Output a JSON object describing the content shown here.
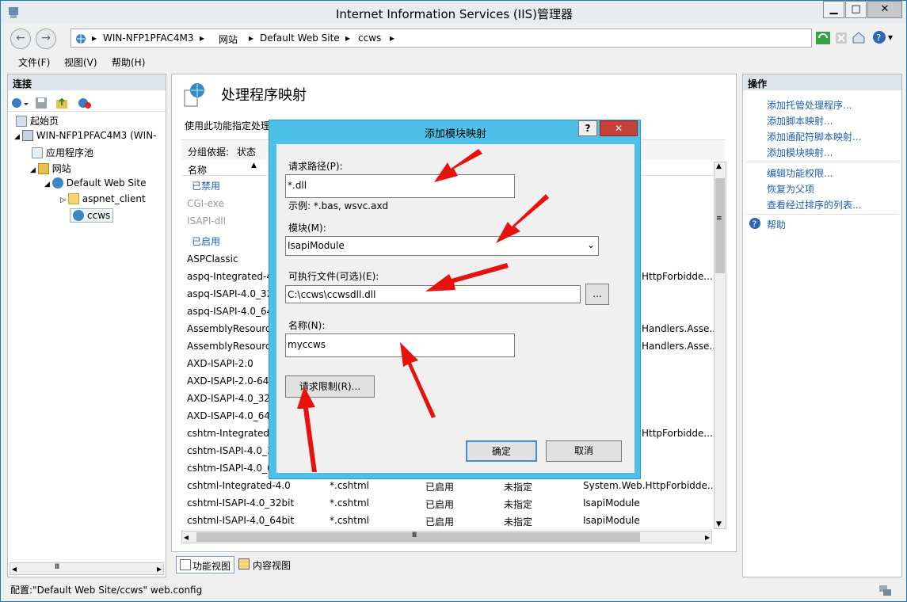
{
  "window": {
    "title": "Internet Information Services (IIS)管理器"
  },
  "address": {
    "segments": [
      "WIN-NFP1PFAC4M3",
      "网站",
      "Default Web Site",
      "ccws"
    ]
  },
  "menu": {
    "file": "文件(F)",
    "view": "视图(V)",
    "help": "帮助(H)"
  },
  "left": {
    "title": "连接",
    "tree": {
      "start": "起始页",
      "server": "WIN-NFP1PFAC4M3 (WIN-",
      "apppools": "应用程序池",
      "sites": "网站",
      "dws": "Default Web Site",
      "aspnet": "aspnet_client",
      "ccws": "ccws"
    }
  },
  "center": {
    "title": "处理程序映射",
    "desc": "使用此功能指定处理",
    "groupby_label": "分组依据:",
    "groupby_value": "状态",
    "col_name": "名称",
    "group_disabled": "已禁用",
    "group_enabled": "已启用",
    "disabled_rows": [
      "CGI-exe",
      "ISAPI-dll"
    ],
    "rows": [
      {
        "name": "ASPClassic",
        "tail": ""
      },
      {
        "name": "aspq-Integrated-4",
        "tail": "HttpForbidde..."
      },
      {
        "name": "aspq-ISAPI-4.0_32",
        "tail": ""
      },
      {
        "name": "aspq-ISAPI-4.0_64",
        "tail": ""
      },
      {
        "name": "AssemblyResourc",
        "tail": "Handlers.Asse..."
      },
      {
        "name": "AssemblyResourc",
        "tail": "Handlers.Asse..."
      },
      {
        "name": "AXD-ISAPI-2.0",
        "tail": ""
      },
      {
        "name": "AXD-ISAPI-2.0-64",
        "tail": ""
      },
      {
        "name": "AXD-ISAPI-4.0_32",
        "tail": ""
      },
      {
        "name": "AXD-ISAPI-4.0_64",
        "tail": ""
      },
      {
        "name": "cshtm-Integrated-",
        "tail": "HttpForbidde..."
      },
      {
        "name": "cshtm-ISAPI-4.0_3",
        "tail": ""
      },
      {
        "name": "cshtm-ISAPI-4.0_6",
        "tail": ""
      }
    ],
    "full_rows": [
      {
        "name": "cshtml-Integrated-4.0",
        "path": "*.cshtml",
        "state": "已启用",
        "type": "未指定",
        "handler": "System.Web.HttpForbidde..."
      },
      {
        "name": "cshtml-ISAPI-4.0_32bit",
        "path": "*.cshtml",
        "state": "已启用",
        "type": "未指定",
        "handler": "IsapiModule"
      },
      {
        "name": "cshtml-ISAPI-4.0_64bit",
        "path": "*.cshtml",
        "state": "已启用",
        "type": "未指定",
        "handler": "IsapiModule"
      }
    ],
    "tab_feature": "功能视图",
    "tab_content": "内容视图"
  },
  "right": {
    "title": "操作",
    "actions": [
      "添加托管处理程序...",
      "添加脚本映射...",
      "添加通配符脚本映射...",
      "添加模块映射..."
    ],
    "actions2": [
      "编辑功能权限...",
      "恢复为父项",
      "查看经过排序的列表..."
    ],
    "help": "帮助"
  },
  "dialog": {
    "title": "添加模块映射",
    "help_btn": "?",
    "close_btn": "✕",
    "path_label": "请求路径(P):",
    "path_value": "*.dll",
    "path_example": "示例: *.bas, wsvc.axd",
    "module_label": "模块(M):",
    "module_value": "IsapiModule",
    "exe_label": "可执行文件(可选)(E):",
    "exe_value": "C:\\ccws\\ccwsdll.dll",
    "browse": "...",
    "name_label": "名称(N):",
    "name_value": "myccws",
    "restrict": "请求限制(R)...",
    "ok": "确定",
    "cancel": "取消"
  },
  "status": {
    "text": "配置:\"Default Web Site/ccws\" web.config"
  },
  "colors": {
    "accent": "#4cc0e8",
    "link": "#1c5fb5",
    "arrow": "#e8120c"
  }
}
